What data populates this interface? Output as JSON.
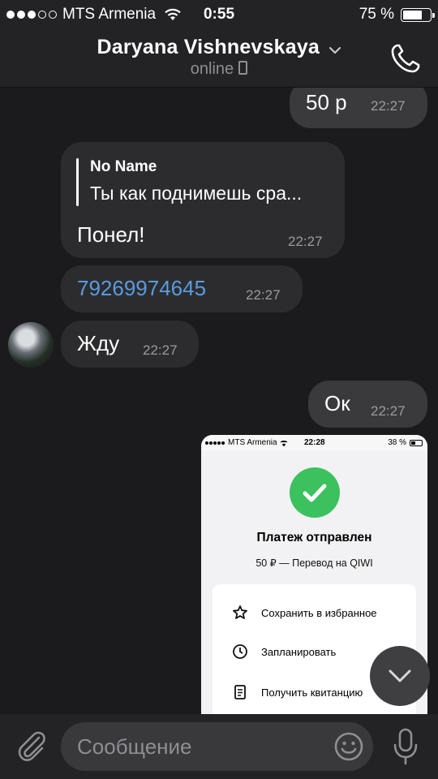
{
  "status_bar": {
    "carrier": "MTS Armenia",
    "time": "0:55",
    "battery_percent": "75 %",
    "battery_level": 0.75
  },
  "header": {
    "title": "Daryana Vishnevskaya",
    "status": "online",
    "icons": [
      "chevron-down-icon",
      "phone-call-icon",
      "mobile-device-icon"
    ]
  },
  "messages": [
    {
      "direction": "outgoing",
      "text": "50 р",
      "time": "22:27"
    },
    {
      "direction": "incoming",
      "reply_to": {
        "author": "No Name",
        "text": "Ты как поднимешь сра..."
      },
      "text": "Понел!",
      "time": "22:27"
    },
    {
      "direction": "incoming",
      "text": "79269974645",
      "time": "22:27",
      "link": true
    },
    {
      "direction": "incoming",
      "text": "Жду",
      "time": "22:27"
    },
    {
      "direction": "outgoing",
      "text": "Ок",
      "time": "22:27"
    }
  ],
  "screenshot": {
    "status": {
      "carrier": "MTS Armenia",
      "time": "22:28",
      "battery": "38 %"
    },
    "title": "Платеж отправлен",
    "subtitle": "50 ₽ — Перевод на QIWI",
    "actions": [
      {
        "label": "Сохранить в избранное",
        "icon": "star-icon"
      },
      {
        "label": "Запланировать",
        "icon": "clock-icon"
      },
      {
        "label": "Получить квитанцию",
        "icon": "receipt-icon"
      }
    ]
  },
  "input": {
    "placeholder": "Сообщение"
  },
  "colors": {
    "background": "#1b1b1d",
    "bar": "#232325",
    "incoming_bubble": "#2c2c2e",
    "outgoing_bubble": "#3a3a3d",
    "link": "#5a9be0",
    "success": "#3cc15f"
  }
}
